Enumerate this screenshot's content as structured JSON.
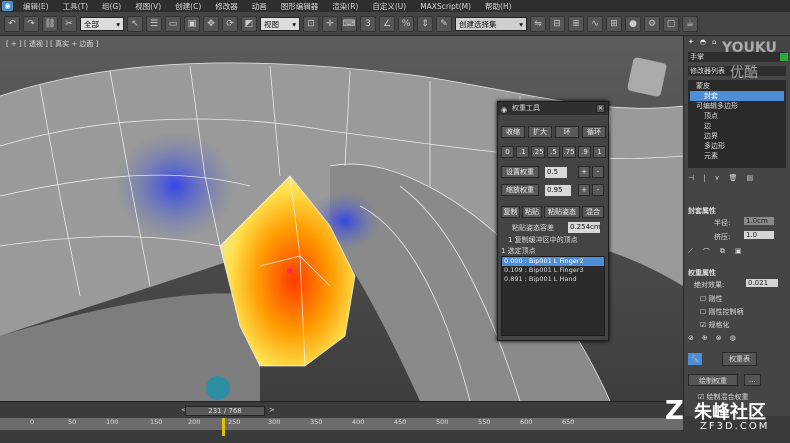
{
  "menu": [
    "编辑(E)",
    "工具(T)",
    "组(G)",
    "视图(V)",
    "创建(C)",
    "修改器",
    "动画",
    "图形编辑器",
    "渲染(R)",
    "自定义(U)",
    "MAXScript(M)",
    "帮助(H)"
  ],
  "toolbar": {
    "selection_filter": "全部",
    "ref_coord": "视图",
    "named_sel": "创建选择集"
  },
  "viewport": {
    "label": "[ + ] [ 透视 ] [ 真实 + 边面 ]"
  },
  "dialog": {
    "title": "权重工具",
    "row1": [
      "收缩",
      "扩大",
      "环",
      "循环"
    ],
    "presets": [
      "0",
      ".1",
      ".25",
      ".5",
      ".75",
      ".9",
      "1"
    ],
    "set_weight_label": "设置权重",
    "set_weight_value": "0.5",
    "scale_weight_label": "缩放权重",
    "scale_weight_value": "0.95",
    "row4": [
      "复制",
      "粘贴",
      "粘贴姿态",
      "混合"
    ],
    "paste_tol_label": "粘贴姿态容差",
    "paste_tol_value": "0.254cm",
    "selected_info": "1 复制缓冲区中的顶点",
    "selected_verts": "1 选定顶点",
    "list": [
      "0.000 : Bip001 L Finger2",
      "0.109 : Bip001 L Finger3",
      "0.891 : Bip001 L Hand"
    ]
  },
  "panel": {
    "object_name": "手掌",
    "modifier_list": "修改器列表",
    "stack": [
      "蒙皮",
      "封套",
      "可编辑多边形",
      "顶点",
      "边",
      "边界",
      "多边形",
      "元素"
    ],
    "envelope_props": "封套属性",
    "radius_label": "半径:",
    "radius_value": "1.0cm",
    "squash_label": "挤压:",
    "squash_value": "1.0",
    "weight_props": "权重属性",
    "abs_effect_label": "绝对效果:",
    "abs_effect_value": "0.021",
    "rigid": "刚性",
    "rigid_handles": "刚性控制柄",
    "normalize": "规格化",
    "weight_table": "权重表",
    "paint_weights": "绘制权重",
    "paint_blend": "绘制混合权重"
  },
  "timeline": {
    "frame": "231 / 768",
    "ticks": [
      "0",
      "50",
      "100",
      "150",
      "200",
      "250",
      "300",
      "350",
      "400",
      "450",
      "500",
      "550",
      "600",
      "650"
    ]
  },
  "watermarks": {
    "youku": "YOUKU",
    "youku_cn": "优酷",
    "zf3d": "朱峰社区",
    "zf3d_url": "ZF3D.COM"
  }
}
